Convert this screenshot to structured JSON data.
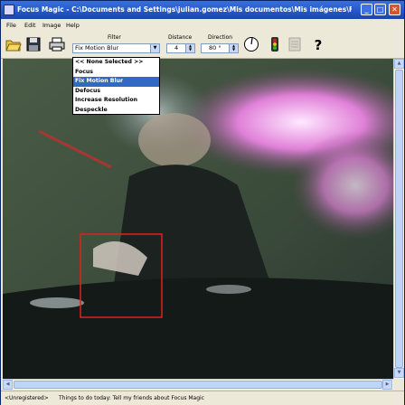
{
  "window": {
    "title": "Focus Magic - C:\\Documents and Settings\\julian.gomez\\Mis documentos\\Mis imágenes\\Fl...",
    "minimize": "_",
    "maximize": "□",
    "close": "✕"
  },
  "menu": {
    "file": "File",
    "edit": "Edit",
    "image": "Image",
    "help": "Help"
  },
  "toolbar": {
    "filter_label": "Filter",
    "filter_value": "Fix Motion Blur",
    "distance_label": "Distance",
    "distance_value": "4",
    "direction_label": "Direction",
    "direction_value": "80 °"
  },
  "filter_options": [
    "<< None Selected >>",
    "Focus",
    "Fix Motion Blur",
    "Defocus",
    "Increase Resolution",
    "Despeckle"
  ],
  "status": {
    "unregistered": "<Unregistered>",
    "tip": "Things to do today: Tell my friends about Focus Magic"
  },
  "colors": {
    "titlebar": "#2456c8",
    "selection": "#316ac5",
    "selection_box": "#e02020"
  }
}
